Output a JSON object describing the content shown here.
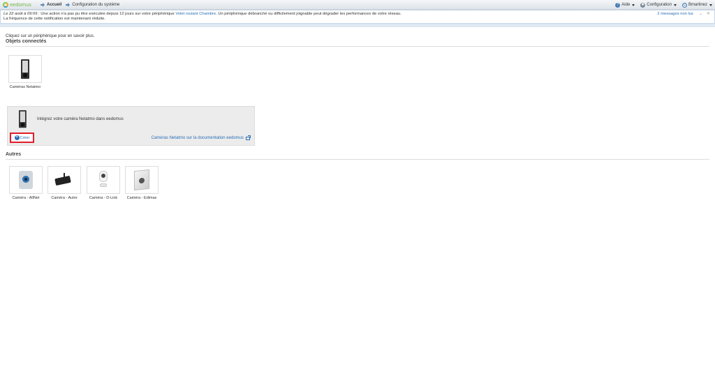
{
  "app": {
    "logo_text": "eedomus"
  },
  "nav": {
    "home": "Accueil",
    "system_config": "Configuration du système"
  },
  "top_right": {
    "help": "Aide",
    "configuration": "Configuration",
    "user": "Bmartinez"
  },
  "notification": {
    "date": "Le 22 août à 09:09",
    "text_before_link": " : Une action n'a pas pu être exécutée depuis 12 jours sur votre périphérique ",
    "link": "Volet roulant Chambre",
    "text_after_link": ". Un périphérique débranché ou difficilement joignable peut dégrader les performances de votre réseau.",
    "line2": "La fréquence de cette notification est maintenant réduite.",
    "unread": "2 messages non lus"
  },
  "main": {
    "hint": "Cliquez sur un périphérique pour en savoir plus.",
    "connected_title": "Objets connectés",
    "connected_tiles": [
      {
        "label": "Caméras Netatmo",
        "icon": "netatmo-camera-icon"
      }
    ],
    "info_panel": {
      "text": "Intégrez votre caméra Netatmo dans eedomus",
      "doc_link": "Caméras Netatmo sur la documentation eedomus",
      "create_label": "Créer"
    },
    "others_title": "Autres",
    "other_tiles": [
      {
        "label": "Caméra - AllNet",
        "icon": "allnet-camera-icon"
      },
      {
        "label": "Caméra - Autre",
        "icon": "generic-camera-icon"
      },
      {
        "label": "Caméra - D-Link",
        "icon": "dlink-camera-icon"
      },
      {
        "label": "Caméra - Edimax",
        "icon": "edimax-camera-icon"
      }
    ]
  },
  "colors": {
    "accent": "#2a6db5",
    "highlight_border": "#e11d2a",
    "panel_bg": "#ececec"
  }
}
